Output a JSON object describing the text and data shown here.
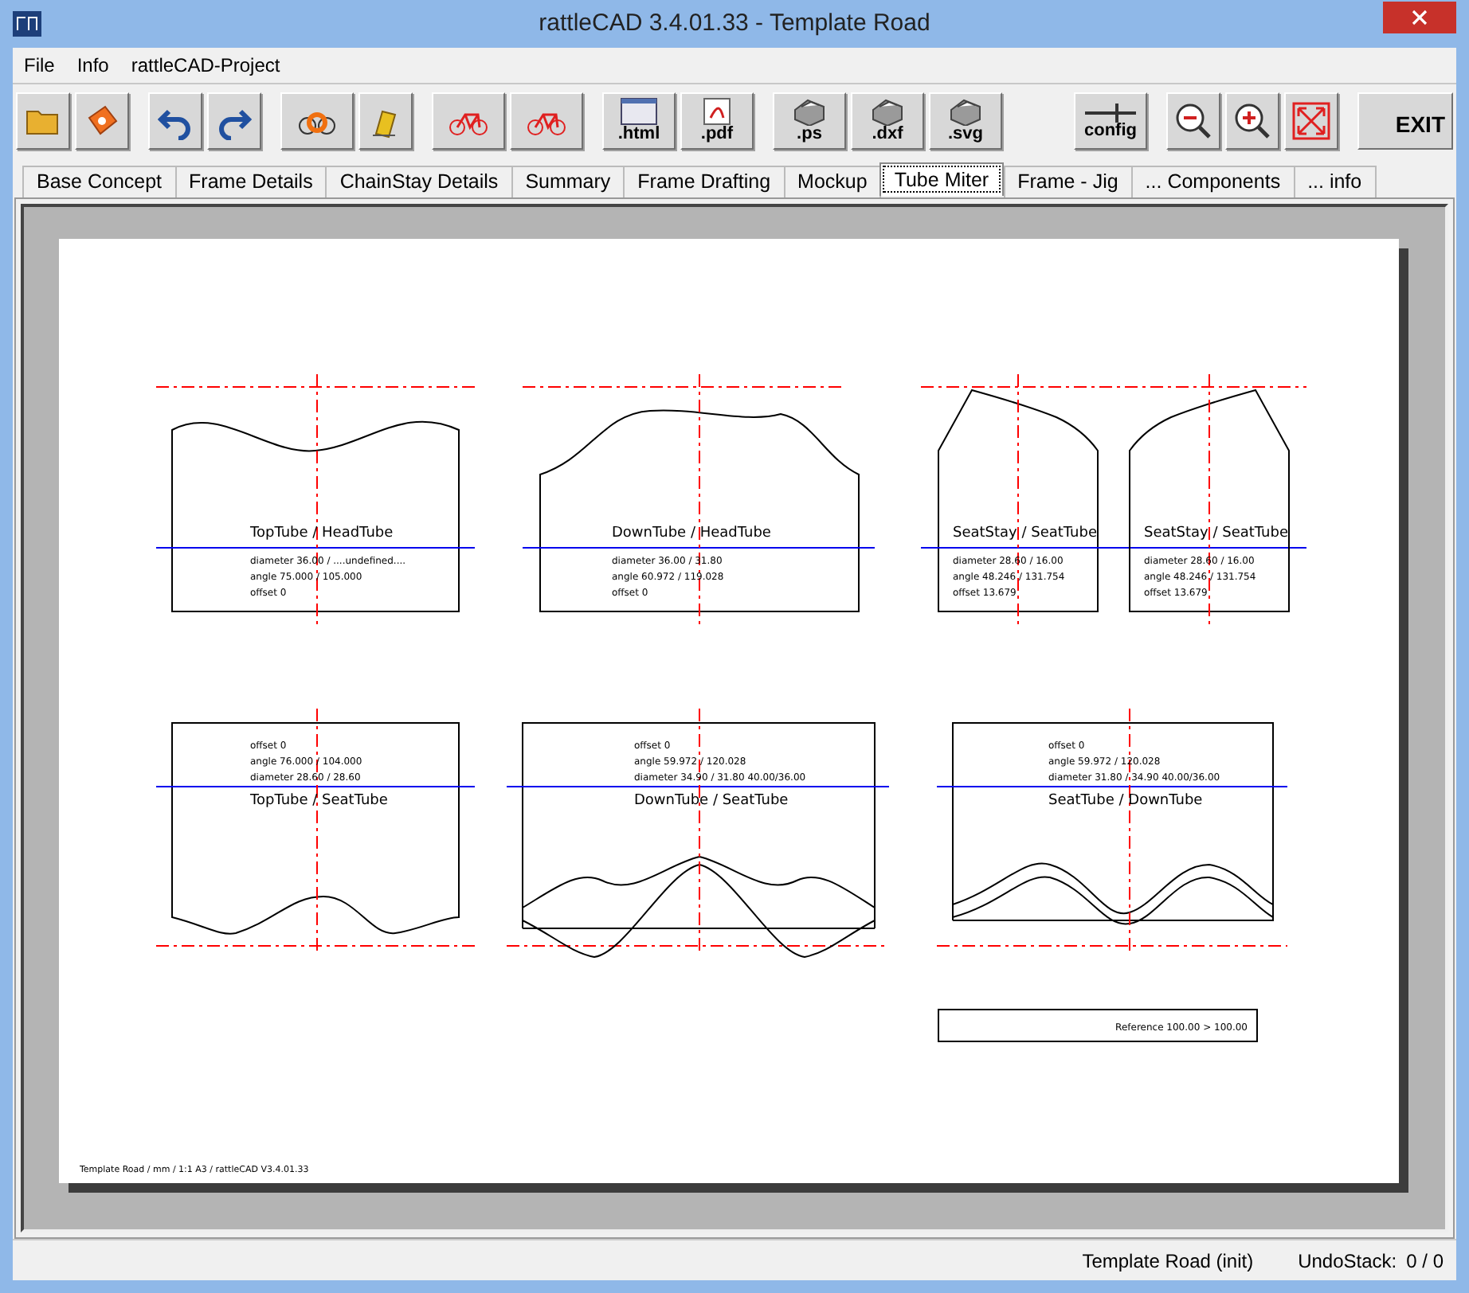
{
  "window": {
    "title": "rattleCAD  3.4.01.33 - Template Road"
  },
  "menu": [
    "File",
    "Info",
    "rattleCAD-Project"
  ],
  "toolbar": {
    "file_buttons": [
      ".html",
      ".pdf",
      ".ps",
      ".dxf",
      ".svg"
    ],
    "config": "config",
    "exit": "EXIT"
  },
  "tabs": [
    {
      "label": "Base Concept",
      "selected": false
    },
    {
      "label": "Frame Details",
      "selected": false
    },
    {
      "label": "ChainStay Details",
      "selected": false
    },
    {
      "label": "Summary",
      "selected": false
    },
    {
      "label": "Frame Drafting",
      "selected": false
    },
    {
      "label": "Mockup",
      "selected": false
    },
    {
      "label": "Tube Miter",
      "selected": true
    },
    {
      "label": "Frame - Jig",
      "selected": false
    },
    {
      "label": "... Components",
      "selected": false
    },
    {
      "label": "... info",
      "selected": false
    }
  ],
  "miters": [
    {
      "title": "TopTube / HeadTube",
      "lines": [
        "diameter 36.00 / ....undefined....",
        "angle 75.000 / 105.000",
        "offset 0"
      ]
    },
    {
      "title": "DownTube / HeadTube",
      "lines": [
        "diameter 36.00 / 31.80",
        "angle 60.972 / 119.028",
        "offset 0"
      ]
    },
    {
      "title": "SeatStay / SeatTube",
      "lines": [
        "diameter 28.60 / 16.00",
        "angle 48.246 / 131.754",
        "offset 13.679"
      ]
    },
    {
      "title": "SeatStay / SeatTube",
      "lines": [
        "diameter 28.60 / 16.00",
        "angle 48.246 / 131.754",
        "offset 13.679"
      ]
    },
    {
      "title": "TopTube / SeatTube",
      "lines": [
        "offset 0",
        "angle 76.000 / 104.000",
        "diameter 28.60 / 28.60"
      ]
    },
    {
      "title": "DownTube / SeatTube",
      "lines": [
        "offset 0",
        "angle 59.972 / 120.028",
        "diameter 34.90 / 31.80 40.00/36.00"
      ]
    },
    {
      "title": "SeatTube / DownTube",
      "lines": [
        "offset 0",
        "angle 59.972 / 120.028",
        "diameter 31.80 / 34.90 40.00/36.00"
      ]
    }
  ],
  "reference": "Reference  100.00 > 100.00",
  "footer": "Template Road  /  mm  /  1:1 A3  /  rattleCAD  V3.4.01.33",
  "status_bar": {
    "template": "Template Road (init)",
    "undo_label": "UndoStack:",
    "undo_value": "0 / 0"
  }
}
